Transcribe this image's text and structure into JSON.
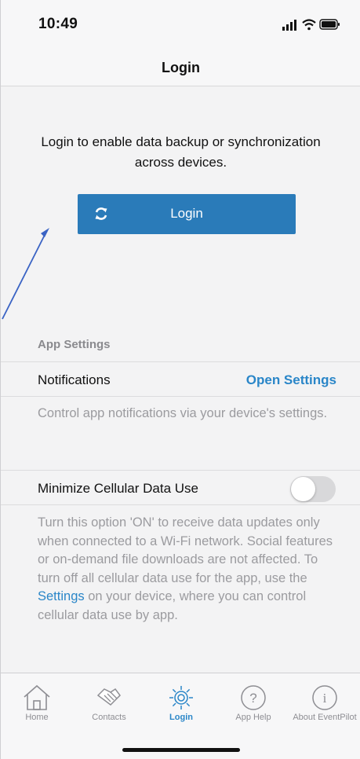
{
  "status_bar": {
    "time": "10:49"
  },
  "nav": {
    "title": "Login"
  },
  "login": {
    "message": "Login to enable data backup or synchronization across devices.",
    "button_label": "Login",
    "button_icon": "refresh-icon"
  },
  "app_settings": {
    "header": "App Settings",
    "notifications": {
      "label": "Notifications",
      "link": "Open Settings",
      "description": "Control app notifications via your device's settings."
    },
    "cellular": {
      "label": "Minimize Cellular Data Use",
      "toggle_on": false,
      "description_before": "Turn this option 'ON' to receive data updates only when connected to a Wi-Fi network. Social features or on-demand file downloads are not affected. To turn off all cellular data use for the app, use the ",
      "description_link": "Settings",
      "description_after": " on your device, where you can control cellular data use by app."
    }
  },
  "tabs": [
    {
      "label": "Home",
      "icon": "home-icon"
    },
    {
      "label": "Contacts",
      "icon": "handshake-icon"
    },
    {
      "label": "Login",
      "icon": "gear-icon",
      "active": true
    },
    {
      "label": "App Help",
      "icon": "question-icon"
    },
    {
      "label": "About EventPilot",
      "icon": "info-icon"
    }
  ],
  "colors": {
    "accent": "#2a86c8",
    "button": "#2a7bb9",
    "secondary_text": "#9b9b9f"
  }
}
